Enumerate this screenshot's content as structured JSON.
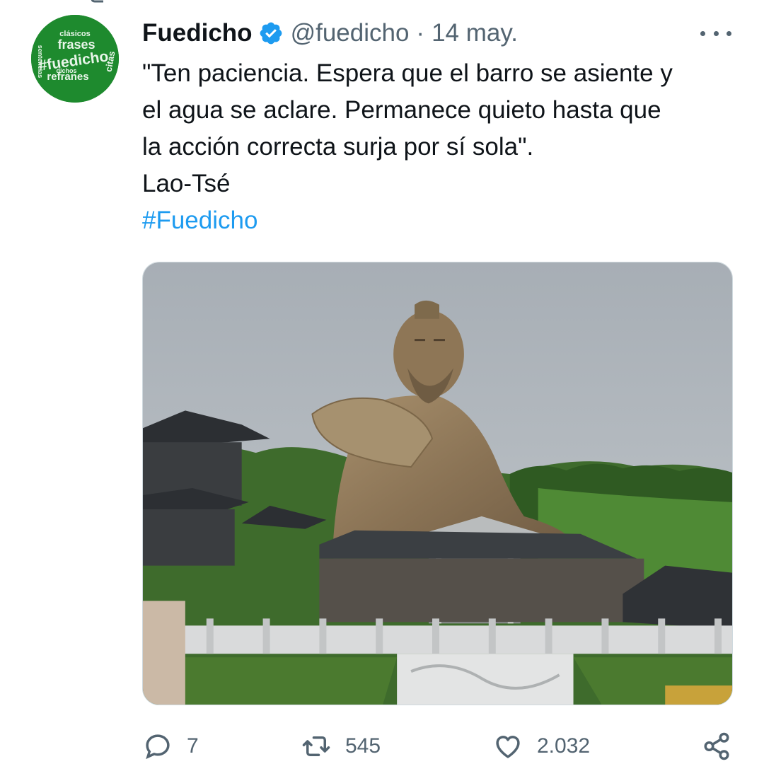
{
  "tweet": {
    "display_name": "Fuedicho",
    "handle": "@fuedicho",
    "separator": "·",
    "date": "14 may.",
    "text_lines": [
      "\"Ten paciencia. Espera que el barro se asiente y",
      "el agua se aclare. Permanece quieto hasta que",
      "la acción correcta surja por sí sola\".",
      "Lao-Tsé"
    ],
    "hashtag": "#Fuedicho",
    "avatar_words": [
      "clásicos",
      "frases",
      "#fuedicho",
      "citas",
      "refranes",
      "dichos",
      "sentencias"
    ]
  },
  "actions": {
    "replies": "7",
    "retweets": "545",
    "likes": "2.032"
  },
  "colors": {
    "text": "#0f1419",
    "secondary": "#536471",
    "link": "#1d9bf0",
    "verified": "#1d9bf0",
    "avatar_bg": "#1e8a2e"
  },
  "icons": [
    "verified-badge-icon",
    "more-icon",
    "reply-icon",
    "retweet-icon",
    "like-icon",
    "share-icon"
  ]
}
